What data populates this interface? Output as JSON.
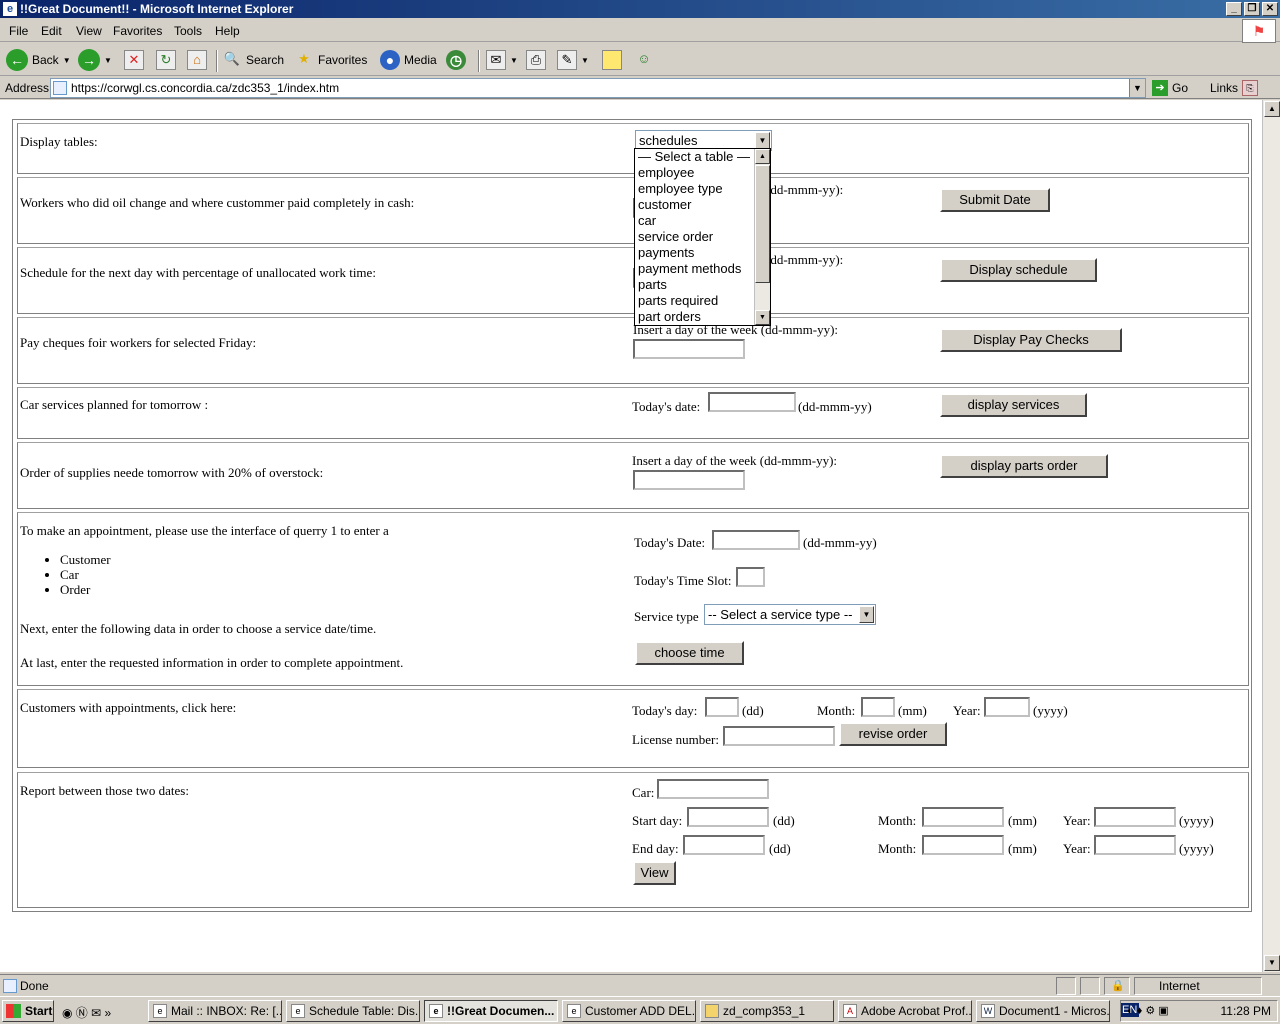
{
  "window": {
    "title": "!!Great Document!! - Microsoft Internet Explorer"
  },
  "menu": [
    "File",
    "Edit",
    "View",
    "Favorites",
    "Tools",
    "Help"
  ],
  "toolbar": {
    "back": "Back",
    "search": "Search",
    "favorites": "Favorites",
    "media": "Media"
  },
  "address": {
    "label": "Address",
    "url": "https://corwgl.cs.concordia.ca/zdc353_1/index.htm",
    "go": "Go",
    "links": "Links"
  },
  "sections": {
    "display_tables": {
      "label": "Display tables:",
      "selected": "schedules"
    },
    "dropdown_options": [
      "— Select a table —",
      "employee",
      "employee type",
      "customer",
      "car",
      "service order",
      "payments",
      "payment methods",
      "parts",
      "parts required",
      "part orders"
    ],
    "oil_change": {
      "label": "Workers who did oil change and where custommer paid completely in cash:",
      "hint": "(dd-mmm-yy):",
      "button": "Submit Date"
    },
    "schedule": {
      "label": "Schedule for the next day with percentage of unallocated work time:",
      "hint": "(dd-mmm-yy):",
      "button": "Display schedule"
    },
    "pay_cheques": {
      "label": "Pay cheques foir workers for selected Friday:",
      "hint": "Insert a day of the week (dd-mmm-yy):",
      "button": "Display Pay Checks"
    },
    "car_services": {
      "label": "Car services planned for tomorrow :",
      "date_label": "Today's date:",
      "format": "(dd-mmm-yy)",
      "button": "display services"
    },
    "supplies": {
      "label": "Order of supplies neede tomorrow with 20% of overstock:",
      "hint": "Insert a day of the week (dd-mmm-yy):",
      "button": "display parts order"
    },
    "appointment": {
      "intro": "To make an appointment, please use the interface of querry 1 to enter a",
      "items": [
        "Customer",
        "Car",
        "Order"
      ],
      "next": "Next, enter the following data in order to choose a service date/time.",
      "last": "At last, enter the requested information in order to complete appointment.",
      "date_label": "Today's Date:",
      "format": "(dd-mmm-yy)",
      "slot_label": "Today's Time Slot:",
      "service_label": "Service type",
      "service_selected": "-- Select a service type --",
      "button": "choose time"
    },
    "customers_appointments": {
      "label": "Customers with appointments, click here:",
      "day_label": "Today's day:",
      "day_fmt": "(dd)",
      "month_label": "Month:",
      "month_fmt": "(mm)",
      "year_label": "Year:",
      "year_fmt": "(yyyy)",
      "license_label": "License number:",
      "button": "revise order"
    },
    "report": {
      "label": "Report between those two dates:",
      "car_label": "Car:",
      "start_label": "Start day:",
      "end_label": "End day:",
      "day_fmt": "(dd)",
      "month_label": "Month:",
      "month_fmt": "(mm)",
      "year_label": "Year:",
      "year_fmt": "(yyyy)",
      "button": "View"
    }
  },
  "status": {
    "text": "Done",
    "zone": "Internet"
  },
  "taskbar": {
    "start": "Start",
    "tasks": [
      "Mail :: INBOX: Re: [...",
      "Schedule Table: Dis...",
      "!!Great Documen...",
      "Customer ADD DEL...",
      "zd_comp353_1",
      "Adobe Acrobat Prof...",
      "Document1 - Micros..."
    ],
    "lang": "EN",
    "clock": "11:28 PM"
  }
}
